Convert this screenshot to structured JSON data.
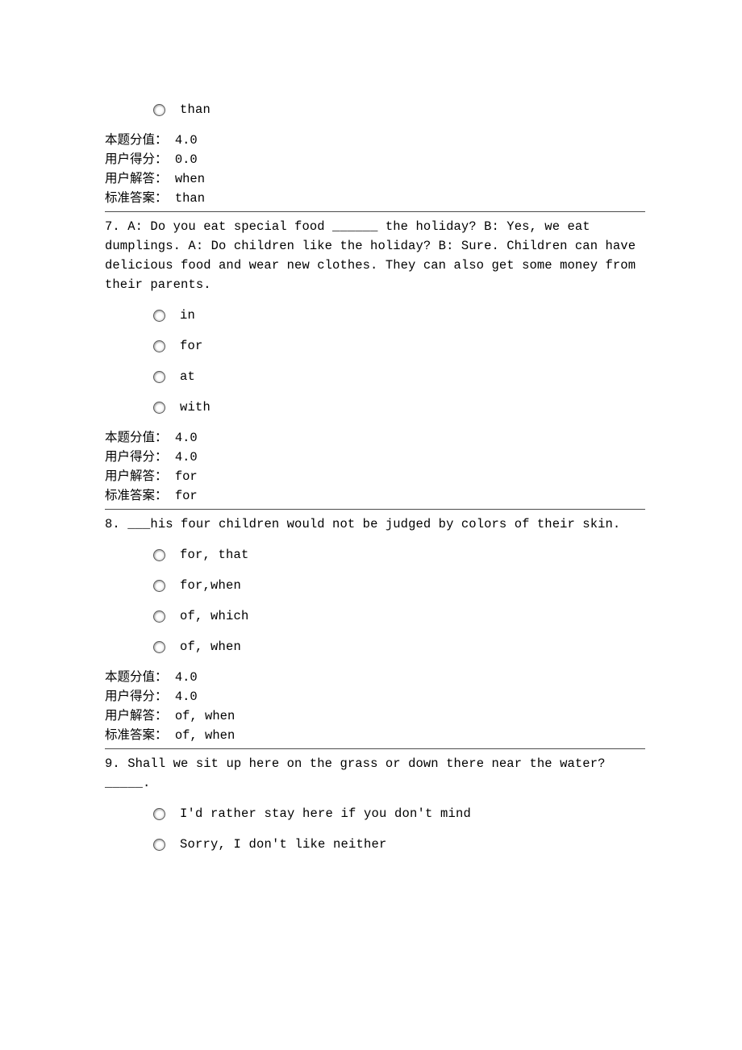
{
  "q6": {
    "option": "than",
    "meta": {
      "score_label": "本题分值：",
      "score_value": "4.0",
      "user_score_label": "用户得分：",
      "user_score_value": "0.0",
      "user_answer_label": "用户解答：",
      "user_answer_value": "when",
      "correct_label": "标准答案：",
      "correct_value": "than"
    }
  },
  "q7": {
    "number": "7.",
    "text": "A: Do you eat special food ______ the holiday? B: Yes, we eat dumplings. A: Do children like the holiday? B: Sure. Children can have delicious food and wear new clothes. They can also get some money from their parents.",
    "options": [
      "in",
      "for",
      "at",
      "with"
    ],
    "meta": {
      "score_label": "本题分值：",
      "score_value": "4.0",
      "user_score_label": "用户得分：",
      "user_score_value": "4.0",
      "user_answer_label": "用户解答：",
      "user_answer_value": "for",
      "correct_label": "标准答案：",
      "correct_value": "for"
    }
  },
  "q8": {
    "number": "8.",
    "text": "___his four children would not be judged by colors of their skin.",
    "options": [
      "for, that",
      "for,when",
      "of, which",
      "of, when"
    ],
    "meta": {
      "score_label": "本题分值：",
      "score_value": "4.0",
      "user_score_label": "用户得分：",
      "user_score_value": "4.0",
      "user_answer_label": "用户解答：",
      "user_answer_value": "of, when",
      "correct_label": "标准答案：",
      "correct_value": "of, when"
    }
  },
  "q9": {
    "number": "9.",
    "text": "Shall we sit up here on the grass or down there near the water? _____.",
    "options": [
      "I'd rather stay here if you don't mind",
      "Sorry, I don't like neither"
    ]
  }
}
